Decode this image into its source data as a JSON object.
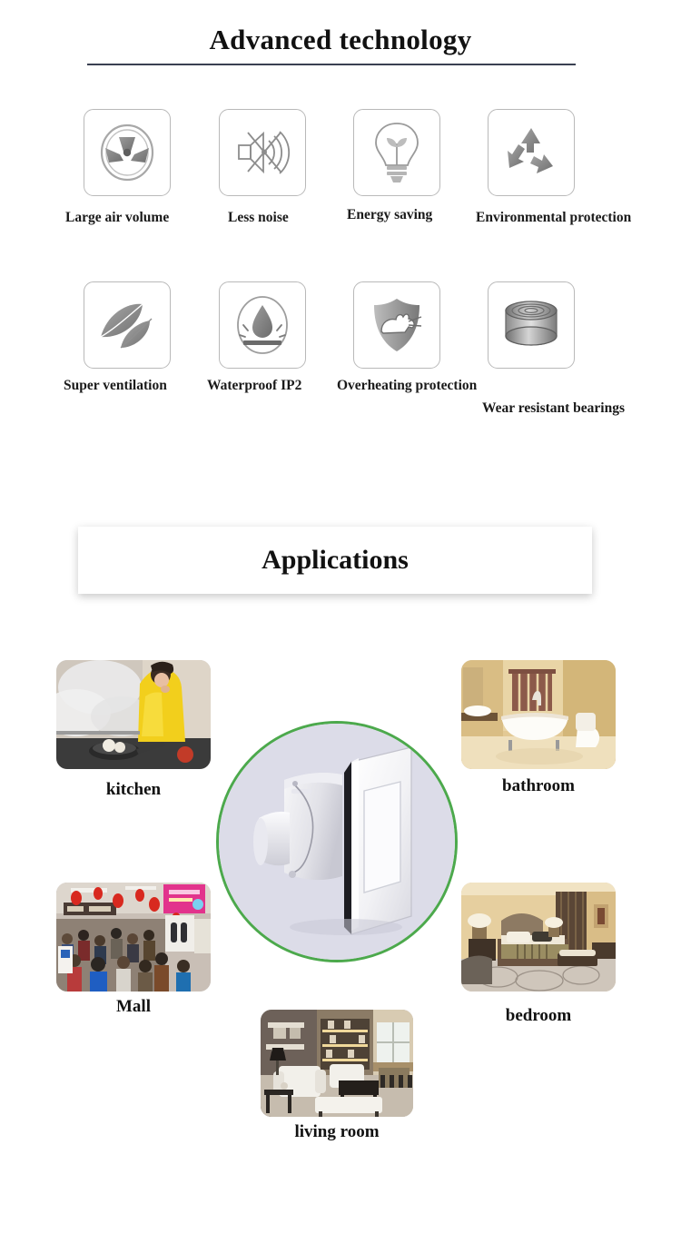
{
  "tech_section": {
    "title": "Advanced technology",
    "features": [
      {
        "label": "Large air volume",
        "icon": "fan-blades-icon"
      },
      {
        "label": "Less noise",
        "icon": "muted-speaker-icon"
      },
      {
        "label": "Energy saving",
        "icon": "lightbulb-leaf-icon"
      },
      {
        "label": "Environmental protection",
        "icon": "recycle-icon"
      },
      {
        "label": "Super ventilation",
        "icon": "two-leaves-icon"
      },
      {
        "label": "Waterproof  IP2",
        "icon": "water-drop-icon"
      },
      {
        "label": "Overheating protection",
        "icon": "shield-rodent-icon"
      },
      {
        "label": "Wear resistant bearings",
        "icon": "bearing-cylinder-icon"
      }
    ]
  },
  "applications_section": {
    "title": "Applications",
    "product_image_alt": "white wall exhaust fan with square front panel",
    "places": [
      {
        "label": "kitchen"
      },
      {
        "label": "bathroom"
      },
      {
        "label": "Mall"
      },
      {
        "label": "bedroom"
      },
      {
        "label": "living room"
      }
    ]
  },
  "colors": {
    "rule": "#3a4052",
    "icon_border": "#b9b9b9",
    "ring_green": "#4ca94c",
    "circle_fill": "#dcdce8",
    "text": "#111111"
  }
}
